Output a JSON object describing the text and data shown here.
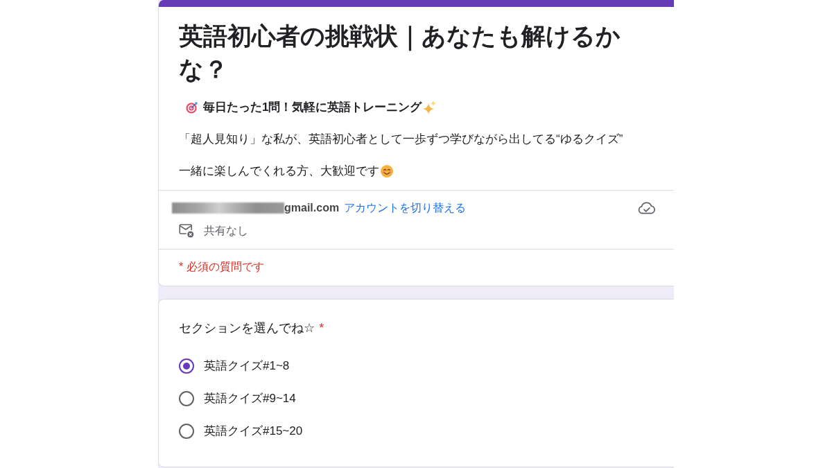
{
  "form": {
    "title": "英語初心者の挑戦状｜あなたも解けるかな？",
    "description": {
      "heading": "毎日たった1問！気軽に英語トレーニング",
      "paragraphs": [
        "「超人見知り」な私が、英語初心者として一歩ずつ学びながら出してる“ゆるクイズ”",
        "一緒に楽しんでくれる方、大歓迎です"
      ]
    },
    "account": {
      "email": "gmail.com",
      "switch_account_link": "アカウントを切り替える",
      "sharing_status": "共有なし"
    },
    "required_note": "* 必須の質問です"
  },
  "question": {
    "title": "セクションを選んでね☆",
    "required_mark": "*",
    "options": [
      {
        "label": "英語クイズ#1~8",
        "selected": true
      },
      {
        "label": "英語クイズ#9~14",
        "selected": false
      },
      {
        "label": "英語クイズ#15~20",
        "selected": false
      }
    ]
  }
}
